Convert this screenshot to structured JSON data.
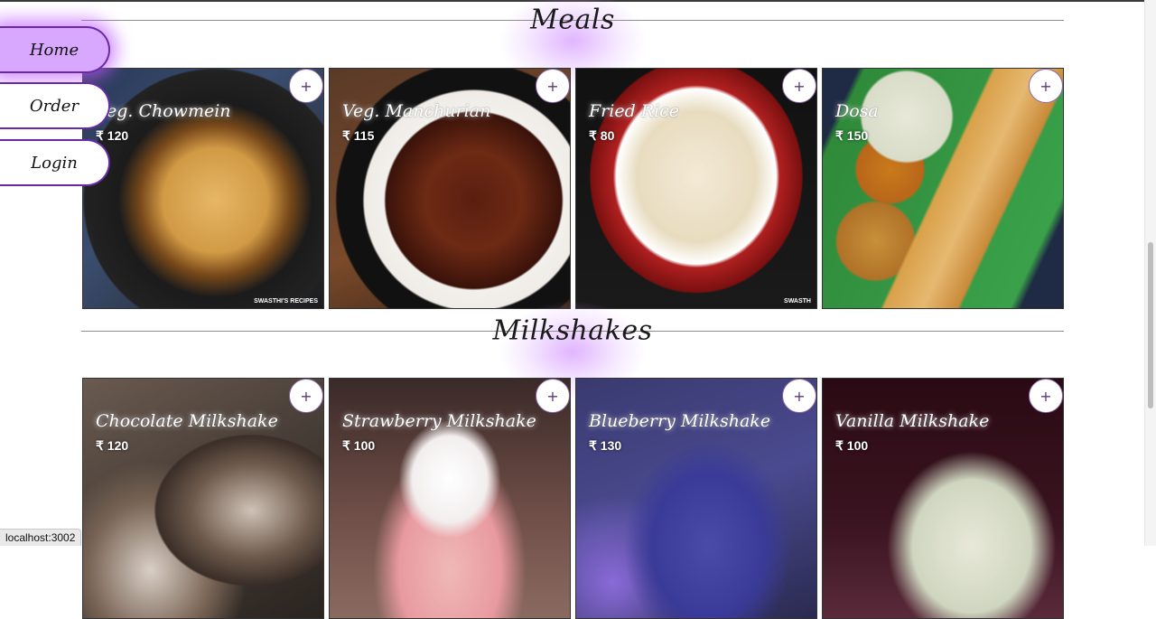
{
  "nav": {
    "items": [
      {
        "label": "Home",
        "active": true
      },
      {
        "label": "Order",
        "active": false
      },
      {
        "label": "Login",
        "active": false
      }
    ]
  },
  "sections": [
    {
      "title": "Meals",
      "items": [
        {
          "name": "Veg. Chowmein",
          "price": "₹ 120",
          "add": "+",
          "credit": "SWASTHI'S RECIPES"
        },
        {
          "name": "Veg. Manchurian",
          "price": "₹ 115",
          "add": "+"
        },
        {
          "name": "Fried Rice",
          "price": "₹ 80",
          "add": "+",
          "credit": "SWASTH"
        },
        {
          "name": "Dosa",
          "price": "₹ 150",
          "add": "+"
        }
      ]
    },
    {
      "title": "Milkshakes",
      "items": [
        {
          "name": "Chocolate Milkshake",
          "price": "₹ 120",
          "add": "+"
        },
        {
          "name": "Strawberry Milkshake",
          "price": "₹ 100",
          "add": "+"
        },
        {
          "name": "Blueberry Milkshake",
          "price": "₹ 130",
          "add": "+"
        },
        {
          "name": "Vanilla Milkshake",
          "price": "₹ 100",
          "add": "+"
        }
      ]
    }
  ],
  "status_url": "localhost:3002",
  "colors": {
    "accent": "#d8a8ff",
    "nav_border": "#6a2aa8",
    "glow": "#be5aff"
  }
}
